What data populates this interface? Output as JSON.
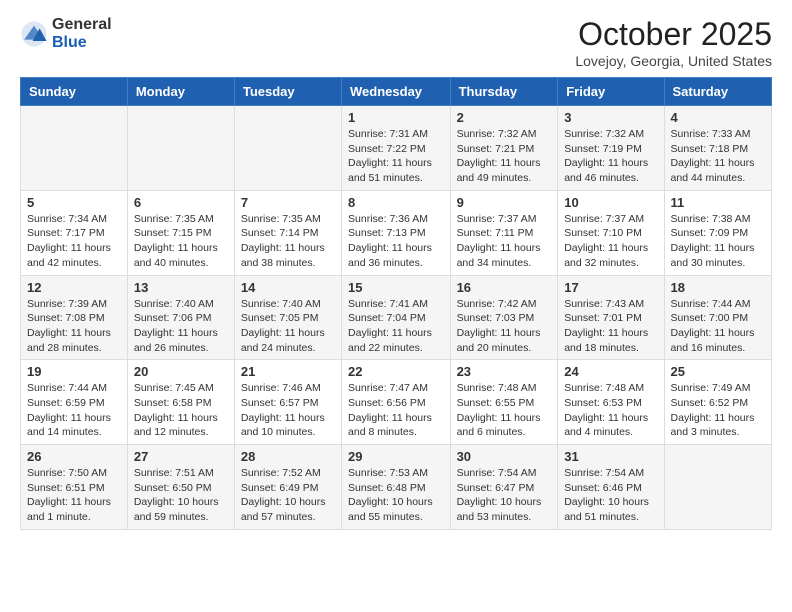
{
  "header": {
    "logo_general": "General",
    "logo_blue": "Blue",
    "month_title": "October 2025",
    "location": "Lovejoy, Georgia, United States"
  },
  "days_of_week": [
    "Sunday",
    "Monday",
    "Tuesday",
    "Wednesday",
    "Thursday",
    "Friday",
    "Saturday"
  ],
  "weeks": [
    [
      {
        "day": "",
        "info": ""
      },
      {
        "day": "",
        "info": ""
      },
      {
        "day": "",
        "info": ""
      },
      {
        "day": "1",
        "info": "Sunrise: 7:31 AM\nSunset: 7:22 PM\nDaylight: 11 hours and 51 minutes."
      },
      {
        "day": "2",
        "info": "Sunrise: 7:32 AM\nSunset: 7:21 PM\nDaylight: 11 hours and 49 minutes."
      },
      {
        "day": "3",
        "info": "Sunrise: 7:32 AM\nSunset: 7:19 PM\nDaylight: 11 hours and 46 minutes."
      },
      {
        "day": "4",
        "info": "Sunrise: 7:33 AM\nSunset: 7:18 PM\nDaylight: 11 hours and 44 minutes."
      }
    ],
    [
      {
        "day": "5",
        "info": "Sunrise: 7:34 AM\nSunset: 7:17 PM\nDaylight: 11 hours and 42 minutes."
      },
      {
        "day": "6",
        "info": "Sunrise: 7:35 AM\nSunset: 7:15 PM\nDaylight: 11 hours and 40 minutes."
      },
      {
        "day": "7",
        "info": "Sunrise: 7:35 AM\nSunset: 7:14 PM\nDaylight: 11 hours and 38 minutes."
      },
      {
        "day": "8",
        "info": "Sunrise: 7:36 AM\nSunset: 7:13 PM\nDaylight: 11 hours and 36 minutes."
      },
      {
        "day": "9",
        "info": "Sunrise: 7:37 AM\nSunset: 7:11 PM\nDaylight: 11 hours and 34 minutes."
      },
      {
        "day": "10",
        "info": "Sunrise: 7:37 AM\nSunset: 7:10 PM\nDaylight: 11 hours and 32 minutes."
      },
      {
        "day": "11",
        "info": "Sunrise: 7:38 AM\nSunset: 7:09 PM\nDaylight: 11 hours and 30 minutes."
      }
    ],
    [
      {
        "day": "12",
        "info": "Sunrise: 7:39 AM\nSunset: 7:08 PM\nDaylight: 11 hours and 28 minutes."
      },
      {
        "day": "13",
        "info": "Sunrise: 7:40 AM\nSunset: 7:06 PM\nDaylight: 11 hours and 26 minutes."
      },
      {
        "day": "14",
        "info": "Sunrise: 7:40 AM\nSunset: 7:05 PM\nDaylight: 11 hours and 24 minutes."
      },
      {
        "day": "15",
        "info": "Sunrise: 7:41 AM\nSunset: 7:04 PM\nDaylight: 11 hours and 22 minutes."
      },
      {
        "day": "16",
        "info": "Sunrise: 7:42 AM\nSunset: 7:03 PM\nDaylight: 11 hours and 20 minutes."
      },
      {
        "day": "17",
        "info": "Sunrise: 7:43 AM\nSunset: 7:01 PM\nDaylight: 11 hours and 18 minutes."
      },
      {
        "day": "18",
        "info": "Sunrise: 7:44 AM\nSunset: 7:00 PM\nDaylight: 11 hours and 16 minutes."
      }
    ],
    [
      {
        "day": "19",
        "info": "Sunrise: 7:44 AM\nSunset: 6:59 PM\nDaylight: 11 hours and 14 minutes."
      },
      {
        "day": "20",
        "info": "Sunrise: 7:45 AM\nSunset: 6:58 PM\nDaylight: 11 hours and 12 minutes."
      },
      {
        "day": "21",
        "info": "Sunrise: 7:46 AM\nSunset: 6:57 PM\nDaylight: 11 hours and 10 minutes."
      },
      {
        "day": "22",
        "info": "Sunrise: 7:47 AM\nSunset: 6:56 PM\nDaylight: 11 hours and 8 minutes."
      },
      {
        "day": "23",
        "info": "Sunrise: 7:48 AM\nSunset: 6:55 PM\nDaylight: 11 hours and 6 minutes."
      },
      {
        "day": "24",
        "info": "Sunrise: 7:48 AM\nSunset: 6:53 PM\nDaylight: 11 hours and 4 minutes."
      },
      {
        "day": "25",
        "info": "Sunrise: 7:49 AM\nSunset: 6:52 PM\nDaylight: 11 hours and 3 minutes."
      }
    ],
    [
      {
        "day": "26",
        "info": "Sunrise: 7:50 AM\nSunset: 6:51 PM\nDaylight: 11 hours and 1 minute."
      },
      {
        "day": "27",
        "info": "Sunrise: 7:51 AM\nSunset: 6:50 PM\nDaylight: 10 hours and 59 minutes."
      },
      {
        "day": "28",
        "info": "Sunrise: 7:52 AM\nSunset: 6:49 PM\nDaylight: 10 hours and 57 minutes."
      },
      {
        "day": "29",
        "info": "Sunrise: 7:53 AM\nSunset: 6:48 PM\nDaylight: 10 hours and 55 minutes."
      },
      {
        "day": "30",
        "info": "Sunrise: 7:54 AM\nSunset: 6:47 PM\nDaylight: 10 hours and 53 minutes."
      },
      {
        "day": "31",
        "info": "Sunrise: 7:54 AM\nSunset: 6:46 PM\nDaylight: 10 hours and 51 minutes."
      },
      {
        "day": "",
        "info": ""
      }
    ]
  ]
}
